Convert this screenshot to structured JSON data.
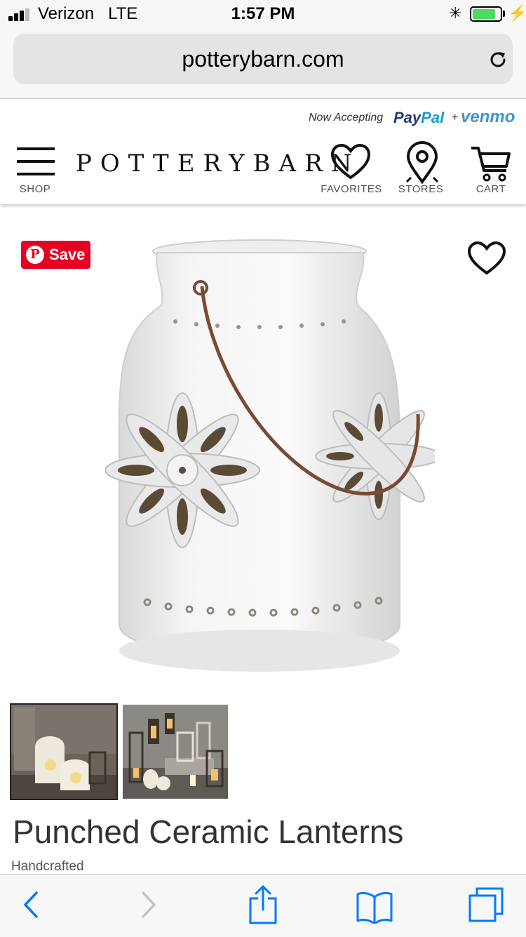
{
  "status_bar": {
    "carrier": "Verizon",
    "network": "LTE",
    "time": "1:57 PM",
    "signal_bars": 4,
    "battery_level": 0.85,
    "icons": [
      "signal-icon",
      "bluetooth-icon",
      "battery-icon",
      "charging-icon"
    ]
  },
  "browser": {
    "url": "potterybarn.com",
    "reload_icon": "reload-icon"
  },
  "site_header": {
    "promo_prefix": "Now Accepting",
    "promo_paypal_a": "Pay",
    "promo_paypal_b": "Pal",
    "promo_plus": "+",
    "promo_venmo": "venmo",
    "logo": "POTTERYBARN",
    "nav": {
      "shop": "SHOP",
      "favorites": "FAVORITES",
      "stores": "STORES",
      "cart": "CART"
    }
  },
  "product": {
    "pin_save_label": "Save",
    "title": "Punched Ceramic Lanterns",
    "subtitle": "Handcrafted",
    "thumbnail_count": 2,
    "selected_thumbnail": 1
  },
  "toolbar": {
    "icons": [
      "back-icon",
      "forward-icon",
      "share-icon",
      "bookmarks-icon",
      "tabs-icon"
    ]
  },
  "colors": {
    "pinterest_red": "#e60023",
    "paypal_dark": "#253b80",
    "paypal_light": "#179bd7",
    "venmo_blue": "#3d95ce",
    "ios_blue": "#007aff",
    "battery_green": "#4cd964"
  }
}
